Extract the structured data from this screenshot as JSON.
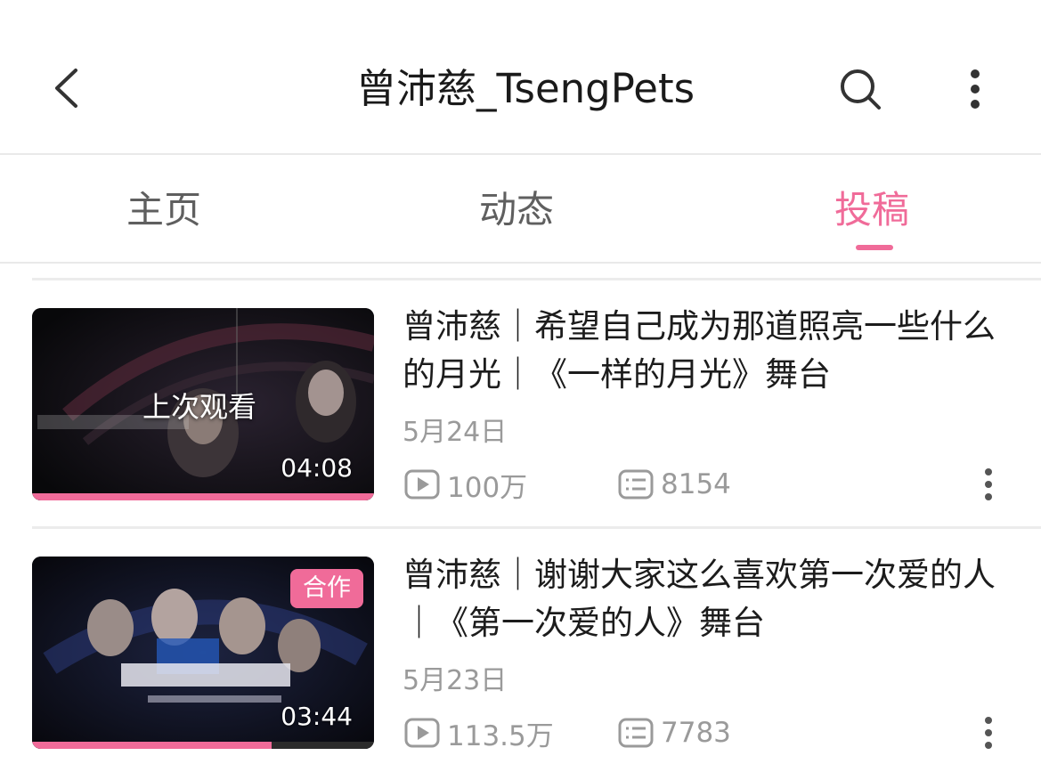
{
  "header": {
    "title": "曾沛慈_TsengPets",
    "back_icon": "back-arrow-icon",
    "search_icon": "search-icon",
    "more_icon": "more-vertical-icon"
  },
  "tabs": [
    {
      "label": "主页",
      "active": false
    },
    {
      "label": "动态",
      "active": false
    },
    {
      "label": "投稿",
      "active": true
    }
  ],
  "colors": {
    "accent": "#f06b99",
    "text_primary": "#1c1c1c",
    "text_secondary": "#9a9a9a",
    "divider": "#ececec"
  },
  "videos": [
    {
      "title": "曾沛慈｜希望自己成为那道照亮一些什么的月光｜《一样的月光》舞台",
      "date": "5月24日",
      "views": "100万",
      "danmaku": "8154",
      "duration": "04:08",
      "overlay_label": "上次观看",
      "badge": "",
      "watch_progress": 1.0
    },
    {
      "title": "曾沛慈｜谢谢大家这么喜欢第一次爱的人｜《第一次爱的人》舞台",
      "date": "5月23日",
      "views": "113.5万",
      "danmaku": "7783",
      "duration": "03:44",
      "overlay_label": "",
      "badge": "合作",
      "watch_progress": 0.7
    }
  ]
}
